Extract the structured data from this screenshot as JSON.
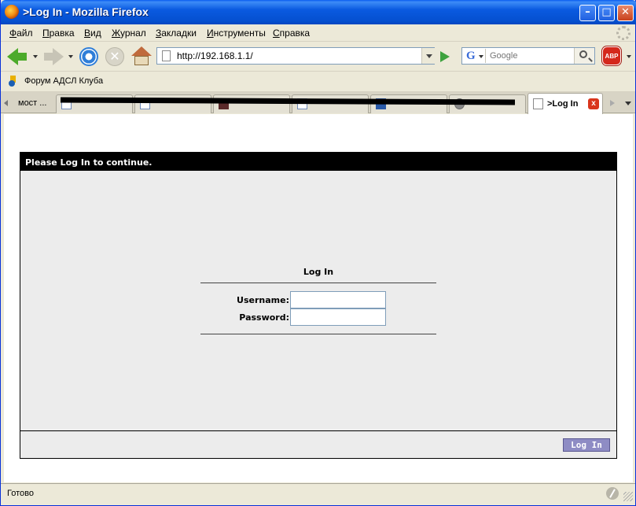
{
  "window": {
    "title": ">Log In - Mozilla Firefox",
    "minimize": "–",
    "maximize": "□",
    "close": "✕"
  },
  "menu": {
    "items": [
      "Файл",
      "Правка",
      "Вид",
      "Журнал",
      "Закладки",
      "Инструменты",
      "Справка"
    ]
  },
  "navbar": {
    "url": "http://192.168.1.1/",
    "search_placeholder": "Google",
    "search_engine": "G",
    "abp_label": "ABP",
    "stop_glyph": "✕"
  },
  "bookmarks": {
    "items": [
      "Форум АДСЛ Клуба"
    ]
  },
  "tabs": {
    "first_label": "мост ...",
    "active_label": ">Log In",
    "close_glyph": "x"
  },
  "page": {
    "header": "Please Log In to continue.",
    "form_title": "Log In",
    "username_label": "Username:",
    "password_label": "Password:",
    "username_value": "",
    "password_value": "",
    "submit_label": "Log In"
  },
  "status": {
    "text": "Готово"
  },
  "colors": {
    "titlebar": "#0a5ae0",
    "panel_header": "#000000",
    "panel_bg": "#ececec",
    "login_button": "#8e8cc4"
  }
}
